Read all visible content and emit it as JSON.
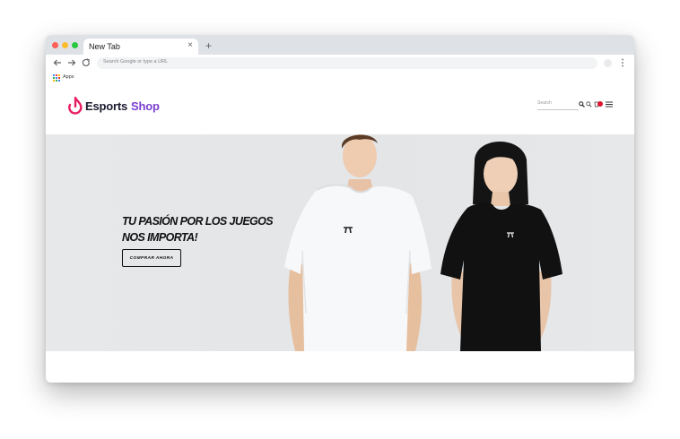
{
  "browser": {
    "tab_title": "New Tab",
    "tab_close": "×",
    "new_tab": "+",
    "omnibox_placeholder": "Search Google or type a URL",
    "bookmarks": {
      "apps_label": "Apps"
    }
  },
  "site": {
    "logo": {
      "part1": "Esports",
      "part2": "Shop"
    },
    "search_placeholder": "Search",
    "hero": {
      "title_line1": "TU PASIÓN POR LOS JUEGOS",
      "title_line2": "NOS IMPORTA!",
      "button_label": "COMPRAR AHORA"
    }
  },
  "colors": {
    "brand_accent": "#7b3fd1",
    "logo_icon": "#e91e63",
    "cart_badge": "#e0142d"
  }
}
